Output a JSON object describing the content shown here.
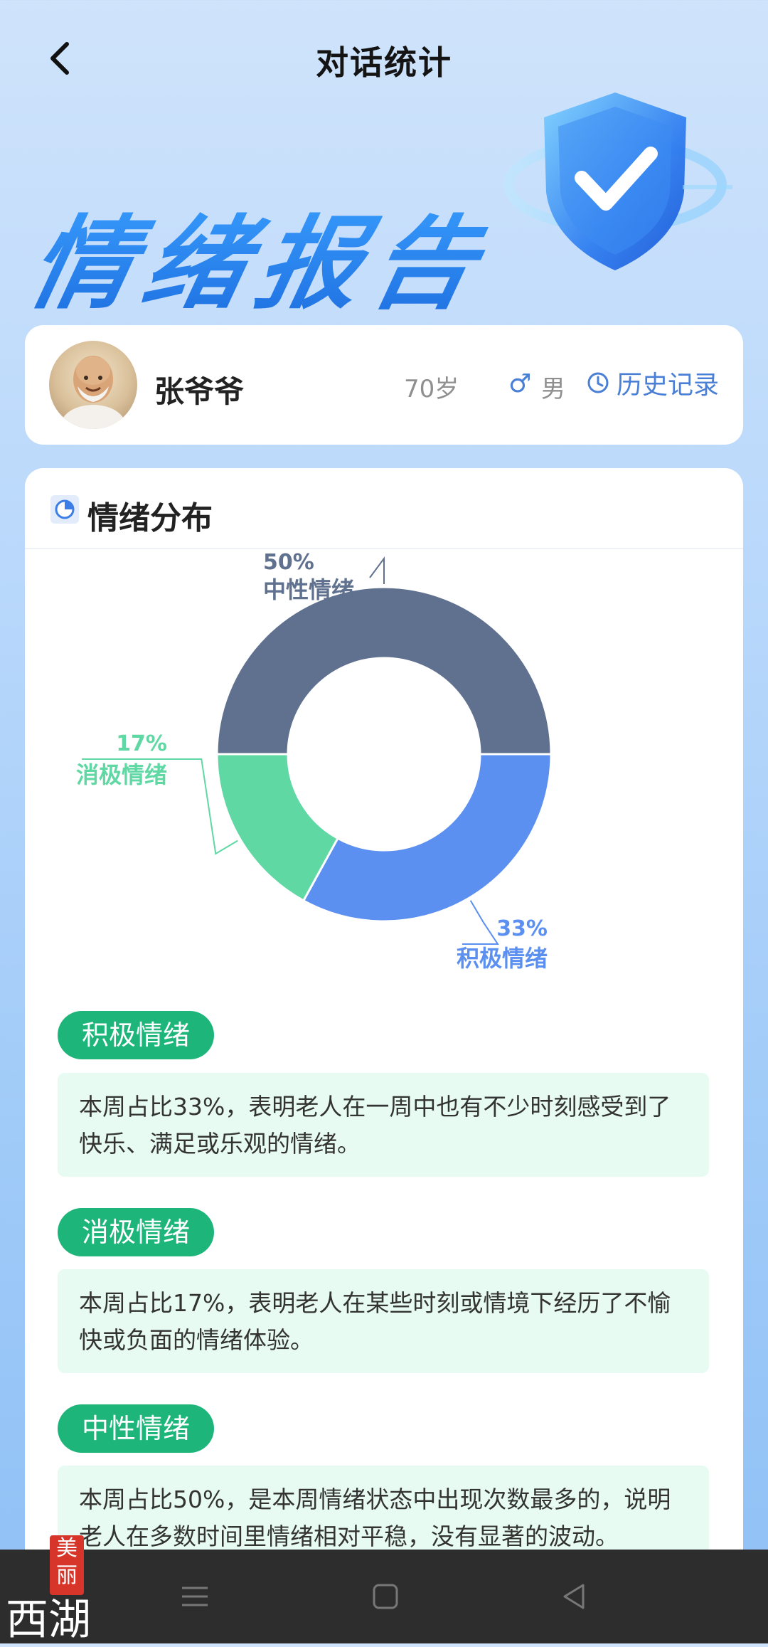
{
  "header": {
    "title": "对话统计",
    "banner": "情绪报告"
  },
  "user": {
    "name": "张爷爷",
    "age": "70岁",
    "gender": "男",
    "history_label": "历史记录"
  },
  "section": {
    "title": "情绪分布"
  },
  "chart_data": {
    "type": "pie",
    "donut": true,
    "slices": [
      {
        "label": "中性情绪",
        "value": 50,
        "display": "50%",
        "color": "#5f718f"
      },
      {
        "label": "积极情绪",
        "value": 33,
        "display": "33%",
        "color": "#5b8ff0"
      },
      {
        "label": "消极情绪",
        "value": 17,
        "display": "17%",
        "color": "#5fd8a4"
      }
    ]
  },
  "details": [
    {
      "tag": "积极情绪",
      "text": "本周占比33%，表明老人在一周中也有不少时刻感受到了快乐、满足或乐观的情绪。"
    },
    {
      "tag": "消极情绪",
      "text": "本周占比17%，表明老人在某些时刻或情境下经历了不愉快或负面的情绪体验。"
    },
    {
      "tag": "中性情绪",
      "text": "本周占比50%，是本周情绪状态中出现次数最多的，说明老人在多数时间里情绪相对平稳，没有显著的波动。"
    }
  ],
  "watermark": {
    "seal": "美丽",
    "text": "西湖"
  },
  "icons": [
    "back-arrow-icon",
    "shield-check-icon",
    "male-icon",
    "clock-icon",
    "pie-chart-icon",
    "menu-icon",
    "home-square-icon",
    "back-triangle-icon"
  ]
}
